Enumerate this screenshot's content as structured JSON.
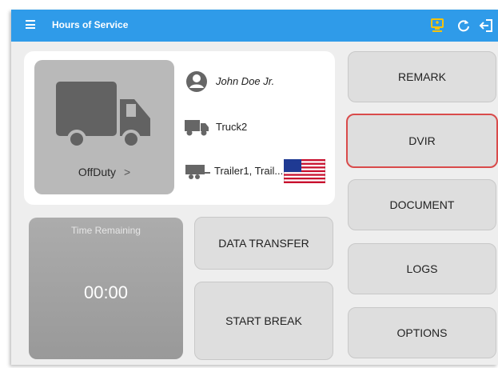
{
  "app_bar": {
    "title": "Hours of Service",
    "icons": [
      "menu-icon",
      "device-sync-icon",
      "refresh-icon",
      "logout-icon"
    ],
    "color": "#2f9be9"
  },
  "status_card": {
    "duty_status": "OffDuty",
    "chevron": ">",
    "driver_name": "John Doe Jr.",
    "truck": "Truck2",
    "trailers": "Trailer1, Trail...",
    "icons": [
      "truck-icon",
      "person-icon",
      "small-truck-icon",
      "trailer-icon",
      "us-flag-icon"
    ]
  },
  "time_remaining": {
    "label": "Time Remaining",
    "value": "00:00"
  },
  "buttons": {
    "data_transfer": "DATA TRANSFER",
    "start_break": "START BREAK",
    "remark": "REMARK",
    "dvir": "DVIR",
    "document": "DOCUMENT",
    "logs": "LOGS",
    "options": "OPTIONS"
  },
  "colors": {
    "selected_outline": "#d94b4b",
    "button_bg": "#dedede"
  }
}
